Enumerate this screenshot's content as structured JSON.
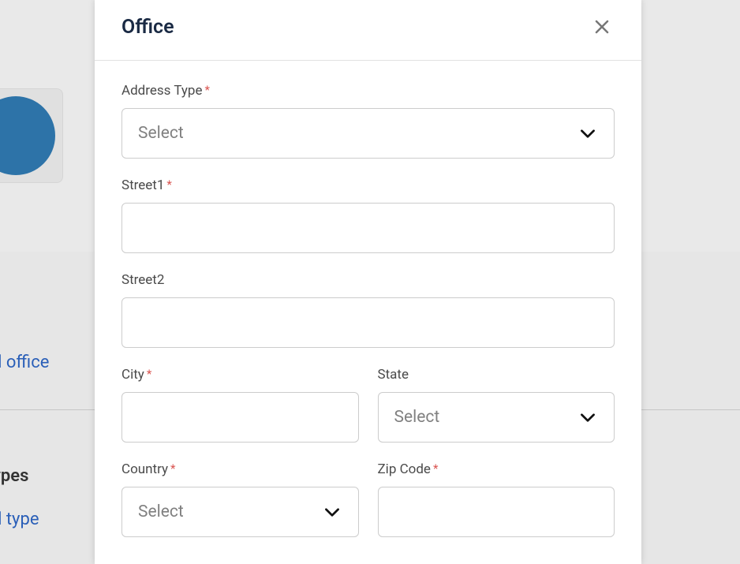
{
  "modal": {
    "title": "Office",
    "fields": {
      "addressType": {
        "label": "Address Type",
        "required": true,
        "placeholder": "Select",
        "value": ""
      },
      "street1": {
        "label": "Street1",
        "required": true,
        "value": ""
      },
      "street2": {
        "label": "Street2",
        "required": false,
        "value": ""
      },
      "city": {
        "label": "City",
        "required": true,
        "value": ""
      },
      "state": {
        "label": "State",
        "required": false,
        "placeholder": "Select",
        "value": ""
      },
      "country": {
        "label": "Country",
        "required": true,
        "placeholder": "Select",
        "value": ""
      },
      "zipCode": {
        "label": "Zip Code",
        "required": true,
        "value": ""
      }
    }
  },
  "background": {
    "linkOffice": "d office",
    "headingTypes": "ypes",
    "linkType": "d type"
  },
  "requiredMark": "*"
}
